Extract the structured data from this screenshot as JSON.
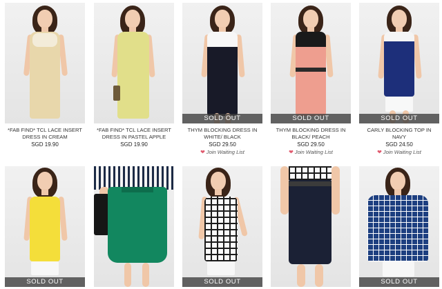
{
  "products": [
    {
      "title": "*FAB FIND* TCL LACE INSERT DRESS IN CREAM",
      "price": "SGD 19.90",
      "sold_out": "",
      "waiting": ""
    },
    {
      "title": "*FAB FIND* TCL LACE INSERT DRESS IN PASTEL APPLE",
      "price": "SGD 19.90",
      "sold_out": "",
      "waiting": ""
    },
    {
      "title": "THYM BLOCKING DRESS IN WHITE/ BLACK",
      "price": "SGD 29.50",
      "sold_out": "SOLD OUT",
      "waiting": "Join Waiting List"
    },
    {
      "title": "THYM BLOCKING DRESS IN BLACK/ PEACH",
      "price": "SGD 29.50",
      "sold_out": "SOLD OUT",
      "waiting": "Join Waiting List"
    },
    {
      "title": "CARLY BLOCKING TOP IN NAVY",
      "price": "SGD 24.50",
      "sold_out": "SOLD OUT",
      "waiting": "Join Waiting List"
    },
    {
      "title": "",
      "price": "",
      "sold_out": "SOLD OUT",
      "waiting": ""
    },
    {
      "title": "",
      "price": "",
      "sold_out": "",
      "waiting": ""
    },
    {
      "title": "",
      "price": "",
      "sold_out": "SOLD OUT",
      "waiting": ""
    },
    {
      "title": "",
      "price": "",
      "sold_out": "",
      "waiting": ""
    },
    {
      "title": "",
      "price": "",
      "sold_out": "SOLD OUT",
      "waiting": ""
    }
  ],
  "colors": {
    "sold_out_banner": "#3c3c3c",
    "heart": "#e05a6e",
    "photo_bg": "#ececec"
  },
  "icons": {
    "waiting_list": "heart-icon"
  }
}
